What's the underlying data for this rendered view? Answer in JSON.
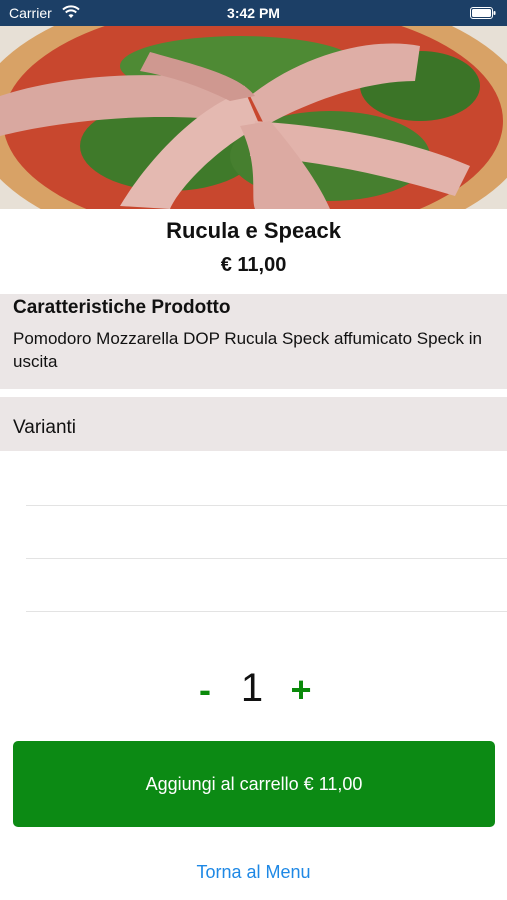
{
  "status_bar": {
    "carrier": "Carrier",
    "time": "3:42 PM"
  },
  "product": {
    "name": "Rucula e Speack",
    "price": "€ 11,00",
    "image_alt": "pizza with speck and rucola"
  },
  "features": {
    "heading": "Caratteristiche Prodotto",
    "description": "Pomodoro Mozzarella DOP Rucula Speck affumicato Speck in uscita"
  },
  "variants": {
    "heading": "Varianti",
    "rows": [
      "",
      "",
      ""
    ]
  },
  "quantity": {
    "minus_label": "-",
    "value": "1",
    "plus_label": "+"
  },
  "actions": {
    "add_to_cart_label": "Aggiungi al carrello € 11,00",
    "back_label": "Torna al Menu"
  },
  "colors": {
    "status_bar": "#1c3f66",
    "section_bg": "#ebe6e6",
    "accent_green": "#0c8a14",
    "link_blue": "#1e88e5"
  }
}
